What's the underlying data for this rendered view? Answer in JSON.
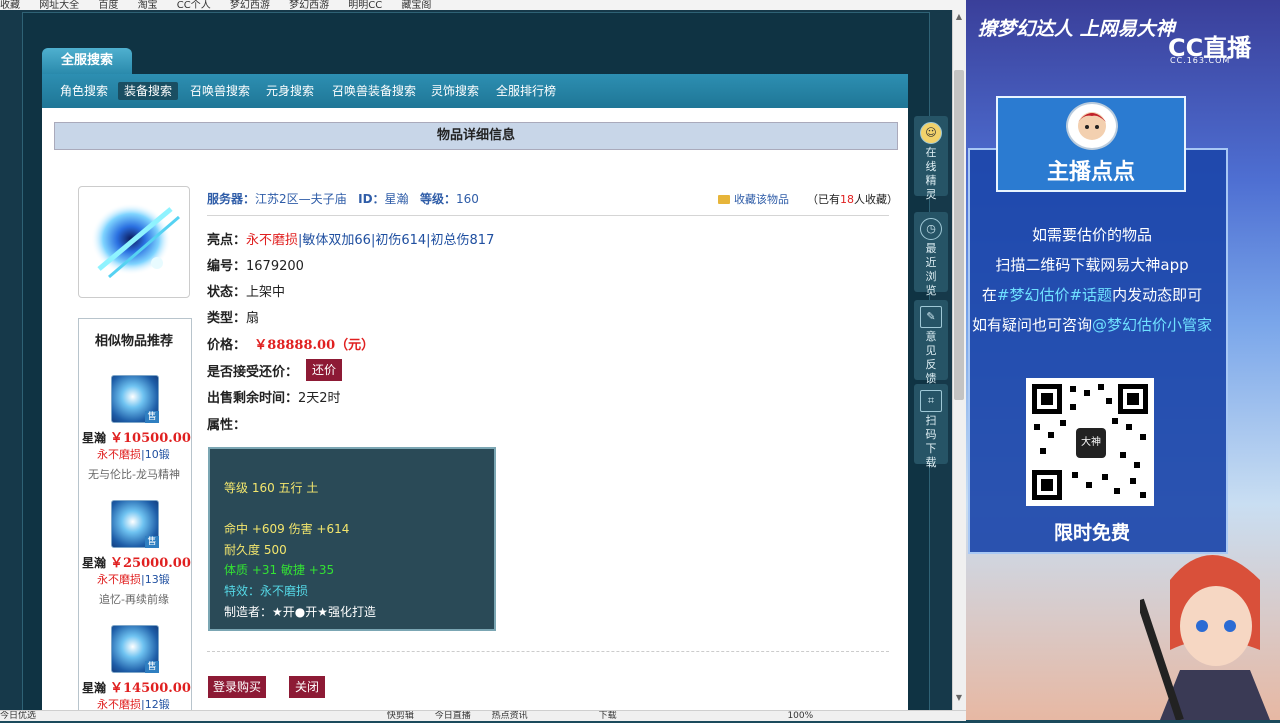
{
  "browser": {
    "bookmarks": [
      "收藏",
      "网址大全",
      "百度",
      "淘宝",
      "CC个人",
      "梦幻西游",
      "梦幻西游",
      "明明CC",
      "藏宝阁"
    ]
  },
  "tabs": {
    "main_label": "全服搜索",
    "nav": [
      "角色搜索",
      "装备搜索",
      "召唤兽搜索",
      "元身搜索",
      "召唤兽装备搜索",
      "灵饰搜索",
      "全服排行榜"
    ]
  },
  "detail": {
    "header": "物品详细信息",
    "server_label": "服务器：",
    "server_value": "江苏2区—夫子庙",
    "id_label": "ID：",
    "id_value": "星瀚",
    "level_label": "等级：",
    "level_value": "160",
    "favorite_label": "收藏该物品",
    "favorite_count_prefix": "（已有",
    "favorite_count": "18",
    "favorite_count_suffix": "人收藏）",
    "highlight_label": "亮点：",
    "highlight_red": "永不磨损",
    "highlight_rest": "|敏体双加66|初伤614|初总伤817",
    "number_label": "编号：",
    "number_value": "1679200",
    "status_label": "状态：",
    "status_value": "上架中",
    "type_label": "类型：",
    "type_value": "扇",
    "price_label": "价格：",
    "price_value": "￥88888.00（元）",
    "counter_label": "是否接受还价：",
    "counter_button": "还价",
    "time_label": "出售剩余时间：",
    "time_value": "2天2时",
    "attr_label": "属性：",
    "attributes": {
      "line1": "等级 160  五行 土",
      "line2": "命中 +609  伤害 +614",
      "line3": "耐久度 500",
      "line4": "体质 +31  敏捷 +35",
      "line5": "特效：永不磨损",
      "line6": "制造者：★开●开★强化打造"
    },
    "buy_button": "登录购买",
    "close_button": "关闭"
  },
  "similar": {
    "title": "相似物品推荐",
    "items": [
      {
        "name": "星瀚",
        "price": "￥10500.00",
        "feat_red": "永不磨损",
        "feat_rest": "|10锻",
        "desc": "无与伦比-龙马精神",
        "badge": "售"
      },
      {
        "name": "星瀚",
        "price": "￥25000.00",
        "feat_red": "永不磨损",
        "feat_rest": "|13锻",
        "desc": "追忆-再续前缘",
        "badge": "售"
      },
      {
        "name": "星瀚",
        "price": "￥14500.00",
        "feat_red": "永不磨损",
        "feat_rest": "|12锻",
        "desc": "",
        "badge": "售"
      }
    ]
  },
  "float_bar": [
    {
      "label": "在线精灵"
    },
    {
      "label": "最近浏览"
    },
    {
      "label": "意见反馈"
    },
    {
      "label": "扫码下载"
    }
  ],
  "statusbar": {
    "items": [
      "今日优选",
      "快剪辑",
      "今日直播",
      "热点资讯",
      "下载",
      "100%"
    ]
  },
  "promo": {
    "slogan": "撩梦幻达人 上网易大神",
    "cc_logo": "CC直播",
    "cc_url": "CC.163.COM",
    "streamer_title": "主播点点",
    "line1": "如需要估价的物品",
    "line2": "扫描二维码下载网易大神app",
    "line3_pre": "在",
    "line3_hl": "#梦幻估价#话题",
    "line3_post": "内发动态即可",
    "line4_pre": "如有疑问也可咨询",
    "line4_hl": "@梦幻估价小管家",
    "qr_center": "大神",
    "free": "限时免费"
  }
}
